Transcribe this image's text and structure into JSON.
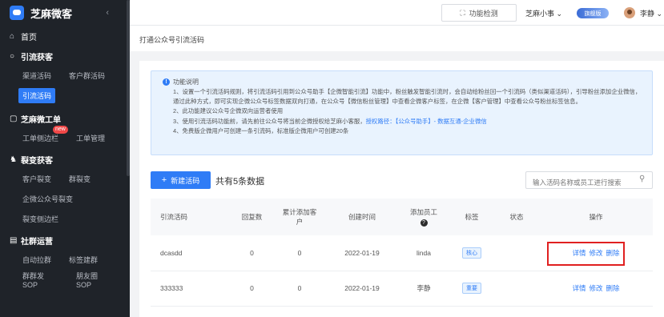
{
  "app": {
    "name": "芝麻微客",
    "collapse_icon": "chevron-left-icon"
  },
  "sidebar": {
    "home": {
      "icon": "home-icon",
      "label": "首页"
    },
    "groups": [
      {
        "title": "引流获客",
        "icon": "user-icon",
        "rows": [
          [
            "渠道活码",
            "客户群活码"
          ],
          [
            "引流活码"
          ]
        ]
      },
      {
        "title": "芝麻微工单",
        "icon": "ticket-icon",
        "rows": [
          [
            "工单侧边栏",
            "工单管理"
          ]
        ]
      },
      {
        "title": "裂变获客",
        "icon": "fission-icon",
        "rows": [
          [
            "客户裂变",
            "群裂变"
          ],
          [
            "企微公众号裂变"
          ],
          [
            "裂变侧边栏"
          ]
        ]
      },
      {
        "title": "社群运营",
        "icon": "community-icon",
        "rows": [
          [
            "自动拉群",
            "标签建群"
          ],
          [
            "群群发SOP",
            "朋友圈SOP"
          ]
        ]
      }
    ],
    "active_item": "引流活码",
    "new_badge": "new"
  },
  "topbar": {
    "detect_label": "功能检测",
    "company": "芝麻小事",
    "vip_badge": "旗舰版",
    "user": "李静"
  },
  "breadcrumb": "打通公众号引流活码",
  "notice": {
    "title": "功能说明",
    "items": [
      "1、设置一个引流活码规则，将引流活码引用到公众号助手【企微智能引流】功能中，粉丝触发智能引流时，会自动给粉丝回一个引流码（类似渠道活码），引导粉丝添加企业微信，通过此种方式，即可实现企微公众号标签数据双向打通，在公众号【微信粉丝管理】中查看企微客户标签，在企微【客户管理】中查看公众号粉丝标签信息。",
      "2、此功能建议公众号企微双向运营者使用",
      "3、使用引流活码功能前，请先前往公众号将当前企微授权给芝麻小客服，",
      "4、免费版企微用户可创建一条引流码，标准版企微用户可创建20条"
    ],
    "link_label": "授权路径：",
    "link_path": "【公众号助手】- 数据互通-企业微信"
  },
  "toolbar": {
    "new_button": "新建活码",
    "count_label": "共有5条数据",
    "search_placeholder": "输入活码名称或员工进行搜索"
  },
  "table": {
    "headers": [
      "引流活码",
      "回复数",
      "累计添加客户",
      "创建时间",
      "添加员工",
      "标签",
      "状态",
      "操作"
    ],
    "rows": [
      {
        "name": "dcasdd",
        "replies": "0",
        "total_added": "0",
        "created": "2022-01-19",
        "staff": "linda",
        "tag": "核心",
        "status": ""
      },
      {
        "name": "333333",
        "replies": "0",
        "total_added": "0",
        "created": "2022-01-19",
        "staff": "李静",
        "tag": "重要",
        "status": ""
      }
    ],
    "actions": {
      "detail": "详情",
      "edit": "修改",
      "delete": "删除"
    }
  }
}
